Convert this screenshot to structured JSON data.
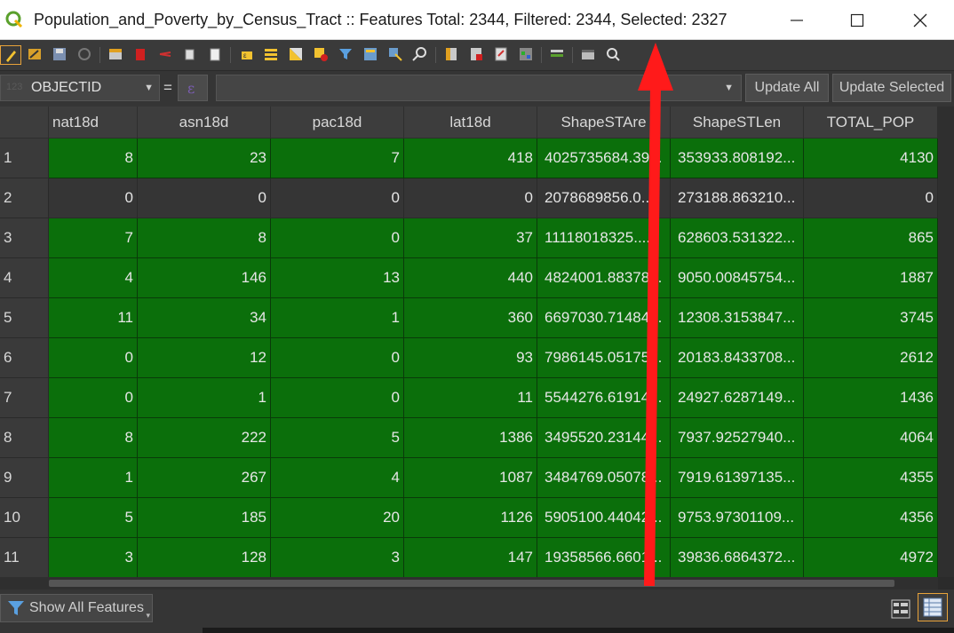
{
  "window": {
    "title": "Population_and_Poverty_by_Census_Tract :: Features Total: 2344, Filtered: 2344, Selected: 2327"
  },
  "toolbar": {
    "icons": [
      "edit-pencil-icon",
      "multi-edit-icon",
      "save-edits-icon",
      "reload-icon",
      "add-feature-icon",
      "delete-feature-icon",
      "cut-icon",
      "copy-icon",
      "paste-icon",
      "select-by-expression-icon",
      "select-all-icon",
      "invert-selection-icon",
      "deselect-icon",
      "filter-icon",
      "move-selection-top-icon",
      "pan-to-selection-icon",
      "zoom-to-selection-icon",
      "new-field-icon",
      "delete-field-icon",
      "field-calculator-icon",
      "conditional-formatting-icon",
      "actions-icon",
      "dock-icon",
      "search-icon"
    ]
  },
  "expression_bar": {
    "field": "OBJECTID",
    "field_hint": "123",
    "equals": "=",
    "value": "",
    "update_all": "Update All",
    "update_selected": "Update Selected"
  },
  "table": {
    "columns": [
      "nat18d",
      "asn18d",
      "pac18d",
      "lat18d",
      "ShapeSTAre",
      "ShapeSTLen",
      "TOTAL_POP"
    ],
    "rows": [
      {
        "num": "1",
        "selected": true,
        "cells": [
          "8",
          "23",
          "7",
          "418",
          "4025735684.39...",
          "353933.808192...",
          "4130"
        ]
      },
      {
        "num": "2",
        "selected": false,
        "cells": [
          "0",
          "0",
          "0",
          "0",
          "2078689856.0...",
          "273188.863210...",
          "0"
        ]
      },
      {
        "num": "3",
        "selected": true,
        "cells": [
          "7",
          "8",
          "0",
          "37",
          "11118018325....",
          "628603.531322...",
          "865"
        ]
      },
      {
        "num": "4",
        "selected": true,
        "cells": [
          "4",
          "146",
          "13",
          "440",
          "4824001.88378...",
          "9050.00845754...",
          "1887"
        ]
      },
      {
        "num": "5",
        "selected": true,
        "cells": [
          "11",
          "34",
          "1",
          "360",
          "6697030.71484...",
          "12308.3153847...",
          "3745"
        ]
      },
      {
        "num": "6",
        "selected": true,
        "cells": [
          "0",
          "12",
          "0",
          "93",
          "7986145.05175...",
          "20183.8433708...",
          "2612"
        ]
      },
      {
        "num": "7",
        "selected": true,
        "cells": [
          "0",
          "1",
          "0",
          "11",
          "5544276.61914...",
          "24927.6287149...",
          "1436"
        ]
      },
      {
        "num": "8",
        "selected": true,
        "cells": [
          "8",
          "222",
          "5",
          "1386",
          "3495520.23144...",
          "7937.92527940...",
          "4064"
        ]
      },
      {
        "num": "9",
        "selected": true,
        "cells": [
          "1",
          "267",
          "4",
          "1087",
          "3484769.05078...",
          "7919.61397135...",
          "4355"
        ]
      },
      {
        "num": "10",
        "selected": true,
        "cells": [
          "5",
          "185",
          "20",
          "1126",
          "5905100.44042...",
          "9753.97301109...",
          "4356"
        ]
      },
      {
        "num": "11",
        "selected": true,
        "cells": [
          "3",
          "128",
          "3",
          "147",
          "19358566.6601...",
          "39836.6864372...",
          "4972"
        ]
      }
    ]
  },
  "status": {
    "show_all": "Show All Features"
  },
  "colors": {
    "selected_row": "#0b6f0b",
    "unselected_row": "#353535",
    "annotation_arrow": "#ff0000",
    "active_border": "#e8a33a"
  }
}
